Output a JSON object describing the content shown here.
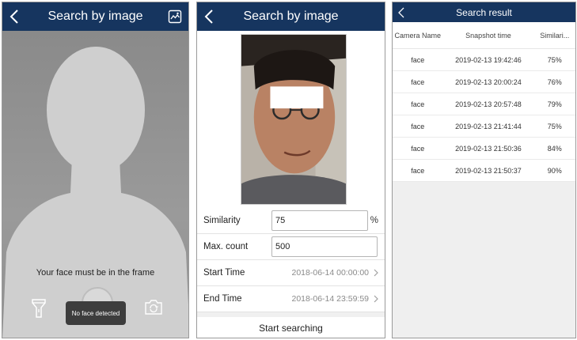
{
  "capture_screen": {
    "title": "Search by image",
    "hint": "Your face must be in the frame",
    "toast": "No face detected"
  },
  "search_screen": {
    "title": "Search by image",
    "similarity": {
      "label": "Similarity",
      "value": "75",
      "unit": "%"
    },
    "max_count": {
      "label": "Max. count",
      "value": "500"
    },
    "start_time": {
      "label": "Start Time",
      "value": "2018-06-14 00:00:00"
    },
    "end_time": {
      "label": "End Time",
      "value": "2018-06-14 23:59:59"
    },
    "start_button": "Start searching"
  },
  "result_screen": {
    "title": "Search result",
    "columns": [
      "Camera Name",
      "Snapshot time",
      "Similari..."
    ],
    "rows": [
      [
        "face",
        "2019-02-13 19:42:46",
        "75%"
      ],
      [
        "face",
        "2019-02-13 20:00:24",
        "76%"
      ],
      [
        "face",
        "2019-02-13 20:57:48",
        "79%"
      ],
      [
        "face",
        "2019-02-13 21:41:44",
        "75%"
      ],
      [
        "face",
        "2019-02-13 21:50:36",
        "84%"
      ],
      [
        "face",
        "2019-02-13 21:50:37",
        "90%"
      ]
    ]
  },
  "colors": {
    "navbar": "#16355f",
    "camera_background": "#8c8c8c",
    "silhouette": "#cfcfcf"
  },
  "icons": {
    "back": "chevron-left-icon",
    "album": "photo-album-icon",
    "flashlight": "flashlight-icon",
    "switch_camera": "switch-camera-icon",
    "chevron_right": "chevron-right-icon"
  }
}
